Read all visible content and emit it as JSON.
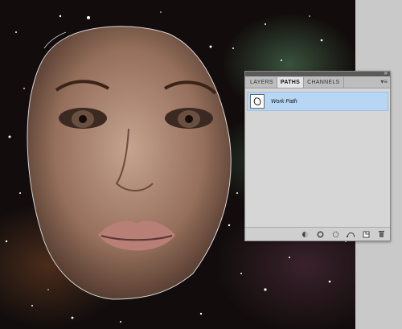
{
  "panel": {
    "tabs": [
      {
        "label": "LAYERS"
      },
      {
        "label": "PATHS"
      },
      {
        "label": "CHANNELS"
      }
    ],
    "active_tab": "PATHS",
    "paths": [
      {
        "name": "Work Path",
        "selected": true
      }
    ],
    "footer_icons": [
      "fill-path-icon",
      "stroke-path-icon",
      "load-selection-icon",
      "make-work-path-icon",
      "new-path-icon",
      "delete-path-icon"
    ]
  },
  "colors": {
    "selected_row": "#b7d6f4",
    "panel_bg": "#d6d6d6"
  }
}
